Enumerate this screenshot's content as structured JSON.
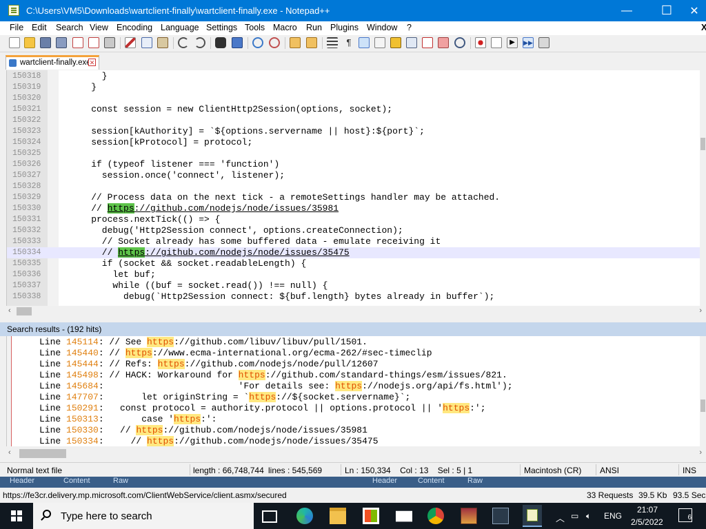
{
  "window": {
    "title": "C:\\Users\\VM5\\Downloads\\wartclient-finally\\wartclient-finally.exe - Notepad++",
    "controls": {
      "minimize": "—",
      "maximize": "☐",
      "close": "✕"
    }
  },
  "menu": [
    "File",
    "Edit",
    "Search",
    "View",
    "Encoding",
    "Language",
    "Settings",
    "Tools",
    "Macro",
    "Run",
    "Plugins",
    "Window",
    "?"
  ],
  "menu_close": "X",
  "toolbar_icons": [
    "new-file-icon",
    "open-file-icon",
    "save-icon",
    "save-all-icon",
    "close-icon",
    "close-all-icon",
    "print-icon",
    "cut-icon",
    "copy-icon",
    "paste-icon",
    "undo-icon",
    "redo-icon",
    "find-icon",
    "replace-icon",
    "zoom-in-icon",
    "zoom-out-icon",
    "sync-vertical-icon",
    "sync-horizontal-icon",
    "word-wrap-icon",
    "show-all-chars-icon",
    "indent-guide-icon",
    "udl-icon",
    "doc-map-icon",
    "doc-list-icon",
    "function-list-icon",
    "folder-workspace-icon",
    "monitor-icon",
    "record-macro-icon",
    "stop-record-icon",
    "play-macro-icon",
    "run-multiple-macro-icon",
    "save-macro-icon"
  ],
  "tab": {
    "label": "wartclient-finally.exe",
    "close": "✕"
  },
  "editor": {
    "current_line": "150334",
    "lines": [
      {
        "num": "150318",
        "code": "      }"
      },
      {
        "num": "150319",
        "code": "    }"
      },
      {
        "num": "150320",
        "code": ""
      },
      {
        "num": "150321",
        "code": "    const session = new ClientHttp2Session(options, socket);"
      },
      {
        "num": "150322",
        "code": ""
      },
      {
        "num": "150323",
        "code": "    session[kAuthority] = `${options.servername || host}:${port}`;"
      },
      {
        "num": "150324",
        "code": "    session[kProtocol] = protocol;"
      },
      {
        "num": "150325",
        "code": ""
      },
      {
        "num": "150326",
        "code": "    if (typeof listener === 'function')"
      },
      {
        "num": "150327",
        "code": "      session.once('connect', listener);"
      },
      {
        "num": "150328",
        "code": ""
      },
      {
        "num": "150329",
        "code": "    // Process data on the next tick - a remoteSettings handler may be attached."
      },
      {
        "num": "150330",
        "pre": "    // ",
        "match": "https",
        "post": "://github.com/nodejs/node/issues/35981"
      },
      {
        "num": "150331",
        "code": "    process.nextTick(() => {"
      },
      {
        "num": "150332",
        "code": "      debug('Http2Session connect', options.createConnection);"
      },
      {
        "num": "150333",
        "code": "      // Socket already has some buffered data - emulate receiving it"
      },
      {
        "num": "150334",
        "pre": "      // ",
        "match": "https",
        "post": "://github.com/nodejs/node/issues/35475"
      },
      {
        "num": "150335",
        "code": "      if (socket && socket.readableLength) {"
      },
      {
        "num": "150336",
        "code": "        let buf;"
      },
      {
        "num": "150337",
        "code": "        while ((buf = socket.read()) !== null) {"
      },
      {
        "num": "150338",
        "code": "          debug(`Http2Session connect: ${buf.length} bytes already in buffer`);"
      }
    ]
  },
  "search": {
    "title": "Search results - (192 hits)",
    "results": [
      {
        "label": "Line ",
        "num": "145114",
        "pre": ": // See ",
        "match": "https",
        "post": "://github.com/libuv/libuv/pull/1501."
      },
      {
        "label": "Line ",
        "num": "145440",
        "pre": ": // ",
        "match": "https",
        "post": "://www.ecma-international.org/ecma-262/#sec-timeclip"
      },
      {
        "label": "Line ",
        "num": "145444",
        "pre": ": // Refs: ",
        "match": "https",
        "post": "://github.com/nodejs/node/pull/12607"
      },
      {
        "label": "Line ",
        "num": "145498",
        "pre": ": // HACK: Workaround for ",
        "match": "https",
        "post": "://github.com/standard-things/esm/issues/821."
      },
      {
        "label": "Line ",
        "num": "145684",
        "pre": ":                         'For details see: ",
        "match": "https",
        "post": "://nodejs.org/api/fs.html');"
      },
      {
        "label": "Line ",
        "num": "147707",
        "pre": ":       let originString = `",
        "match": "https",
        "post": "://${socket.servername}`;"
      },
      {
        "label": "Line ",
        "num": "150291",
        "pre": ":   const protocol = authority.protocol || options.protocol || '",
        "match": "https",
        "post": ":';"
      },
      {
        "label": "Line ",
        "num": "150313",
        "pre": ":       case '",
        "match": "https",
        "post": ":':"
      },
      {
        "label": "Line ",
        "num": "150330",
        "pre": ":   // ",
        "match": "https",
        "post": "://github.com/nodejs/node/issues/35981"
      },
      {
        "label": "Line ",
        "num": "150334",
        "pre": ":     // ",
        "match": "https",
        "post": "://github.com/nodejs/node/issues/35475"
      }
    ]
  },
  "status": {
    "type": "Normal text file",
    "length": "length : 66,748,744",
    "lines": "lines : 545,569",
    "position": "Ln : 150,334    Col : 13    Sel : 5 | 1",
    "eol": "Macintosh (CR)",
    "encoding": "ANSI",
    "mode": "INS"
  },
  "background_app": {
    "tabs_left": [
      "Header",
      "Content",
      "Raw"
    ],
    "tabs_right": [
      "Header",
      "Content",
      "Raw"
    ],
    "url": "https://fe3cr.delivery.mp.microsoft.com/ClientWebService/client.asmx/secured",
    "requests": "33 Requests",
    "size": "39.5 Kb",
    "time": "93.5 Sec"
  },
  "taskbar": {
    "search_placeholder": "Type here to search",
    "language": "ENG",
    "time": "21:07",
    "date": "2/5/2022",
    "notifications": "6"
  },
  "colors": {
    "titlebar": "#0078d7",
    "match_highlight": "#5ec44a",
    "search_header": "#c4d6ec",
    "taskbar": "#101820"
  }
}
